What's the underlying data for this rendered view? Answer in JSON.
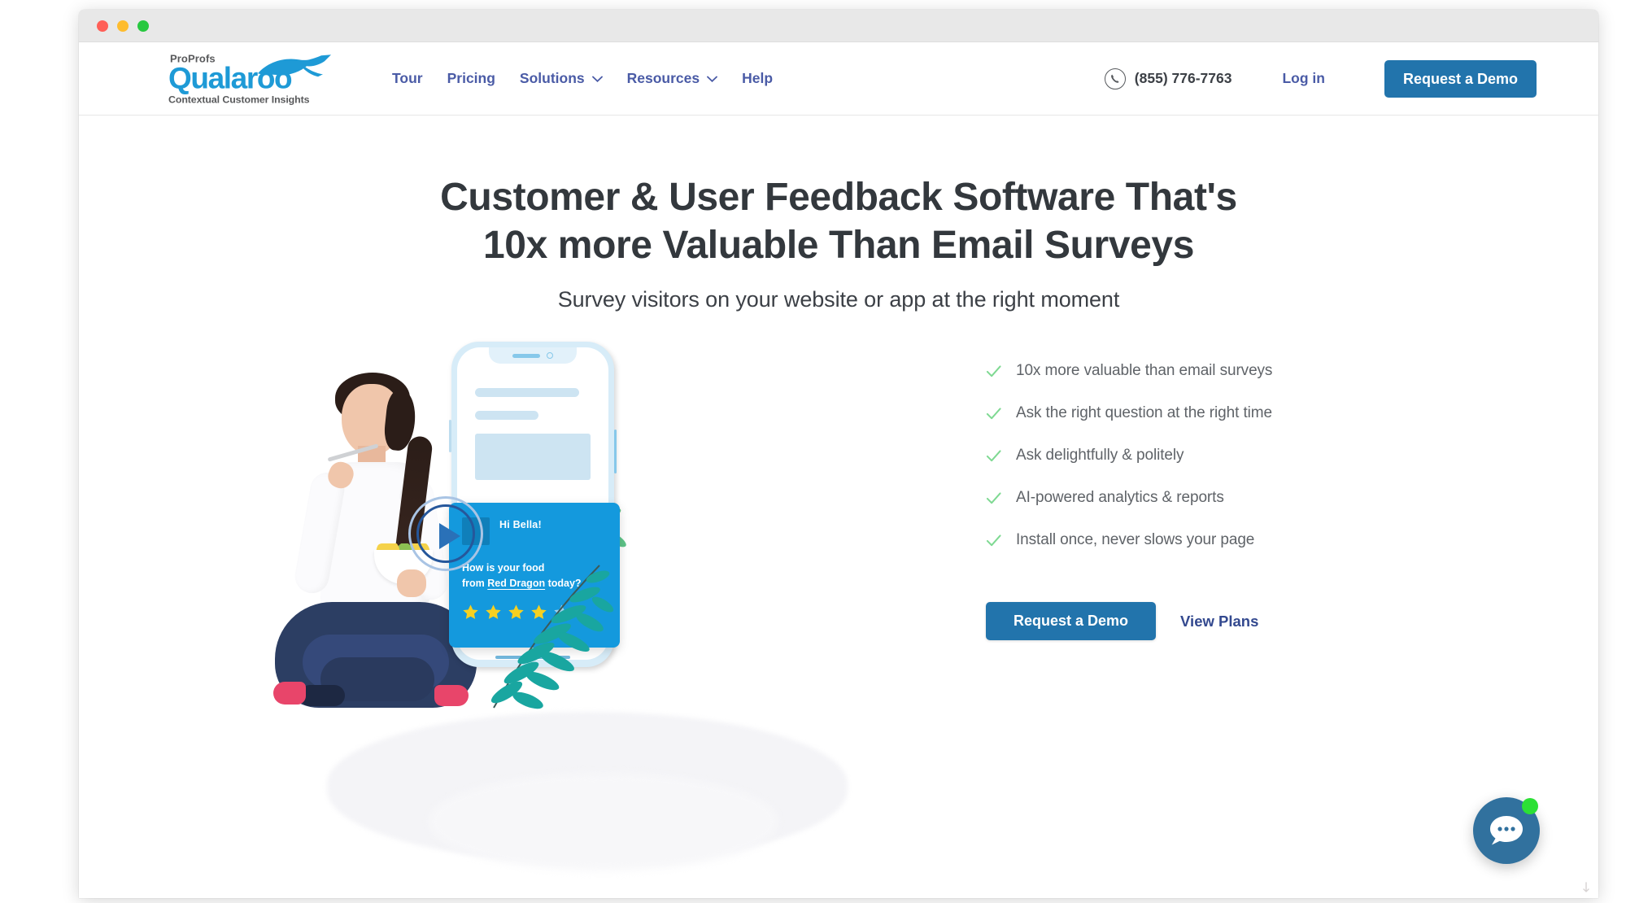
{
  "window": {
    "traffic_lights": [
      "close",
      "minimize",
      "maximize"
    ]
  },
  "header": {
    "logo": {
      "brand_prefix": "ProProfs",
      "brand_name": "Qualaroo",
      "tagline": "Contextual Customer Insights",
      "brand_color": "#1e9ad6",
      "text_color": "#58595b"
    },
    "nav": [
      {
        "label": "Tour",
        "has_dropdown": false
      },
      {
        "label": "Pricing",
        "has_dropdown": false
      },
      {
        "label": "Solutions",
        "has_dropdown": true
      },
      {
        "label": "Resources",
        "has_dropdown": true
      },
      {
        "label": "Help",
        "has_dropdown": false
      }
    ],
    "phone": "(855) 776-7763",
    "login_label": "Log in",
    "demo_label": "Request a Demo",
    "nav_color": "#4a5ba6",
    "button_color": "#2274ac"
  },
  "hero": {
    "title_line1": "Customer & User Feedback Software That's",
    "title_line2": "10x more Valuable Than Email Surveys",
    "subtitle": "Survey visitors on your website or app at the right moment",
    "features": [
      "10x more valuable than email surveys",
      "Ask the right question at the right time",
      "Ask delightfully & politely",
      "AI-powered analytics & reports",
      "Install once, never slows your page"
    ],
    "check_color": "#7ed992",
    "cta_primary": "Request a Demo",
    "cta_secondary": "View Plans"
  },
  "survey_card": {
    "greeting": "Hi Bella!",
    "question_line1": "How is your food",
    "question_prefix": "from ",
    "question_link": "Red Dragon",
    "question_suffix": " today?",
    "rating_filled": 4,
    "rating_total": 5,
    "card_color": "#1499dd",
    "star_color": "#f5d021",
    "star_empty_color": "#9fd1ee"
  },
  "chat": {
    "icon": "chat-bubble-icon",
    "status": "online",
    "status_color": "#2ce035",
    "button_color": "#31719e"
  }
}
